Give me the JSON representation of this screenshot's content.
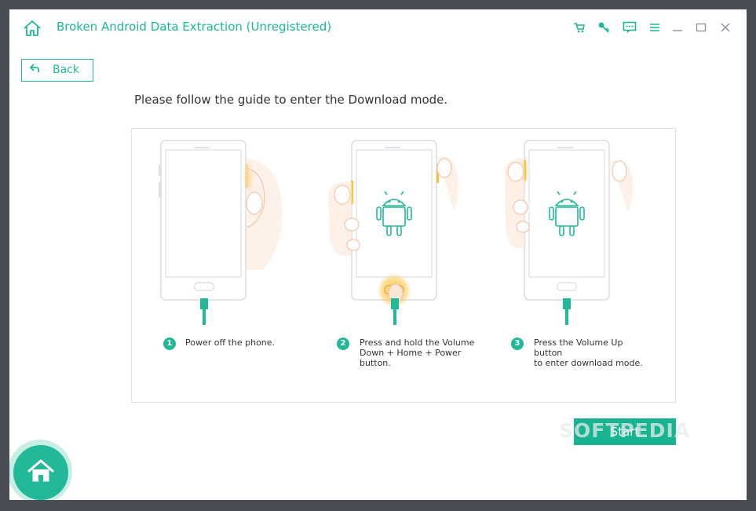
{
  "app": {
    "title": "Broken Android Data Extraction (Unregistered)"
  },
  "titlebar_icons": [
    "cart-icon",
    "key-icon",
    "feedback-icon",
    "menu-icon",
    "minimize-icon",
    "maximize-icon",
    "close-icon"
  ],
  "back_button": {
    "label": "Back"
  },
  "guide": {
    "heading": "Please follow the guide to enter the Download mode."
  },
  "steps": [
    {
      "number": "1",
      "text": "Power off the phone."
    },
    {
      "number": "2",
      "text": "Press and hold the Volume\nDown + Home + Power\nbutton."
    },
    {
      "number": "3",
      "text": "Press the Volume Up button\nto enter download mode."
    }
  ],
  "start_button": {
    "label": "Start"
  },
  "watermark": "SOFTPEDIA",
  "colors": {
    "accent": "#1ab896",
    "button": "#17b491",
    "finger": "#f5b98c",
    "press": "#f8c23a",
    "frame": "#4a4e54"
  }
}
